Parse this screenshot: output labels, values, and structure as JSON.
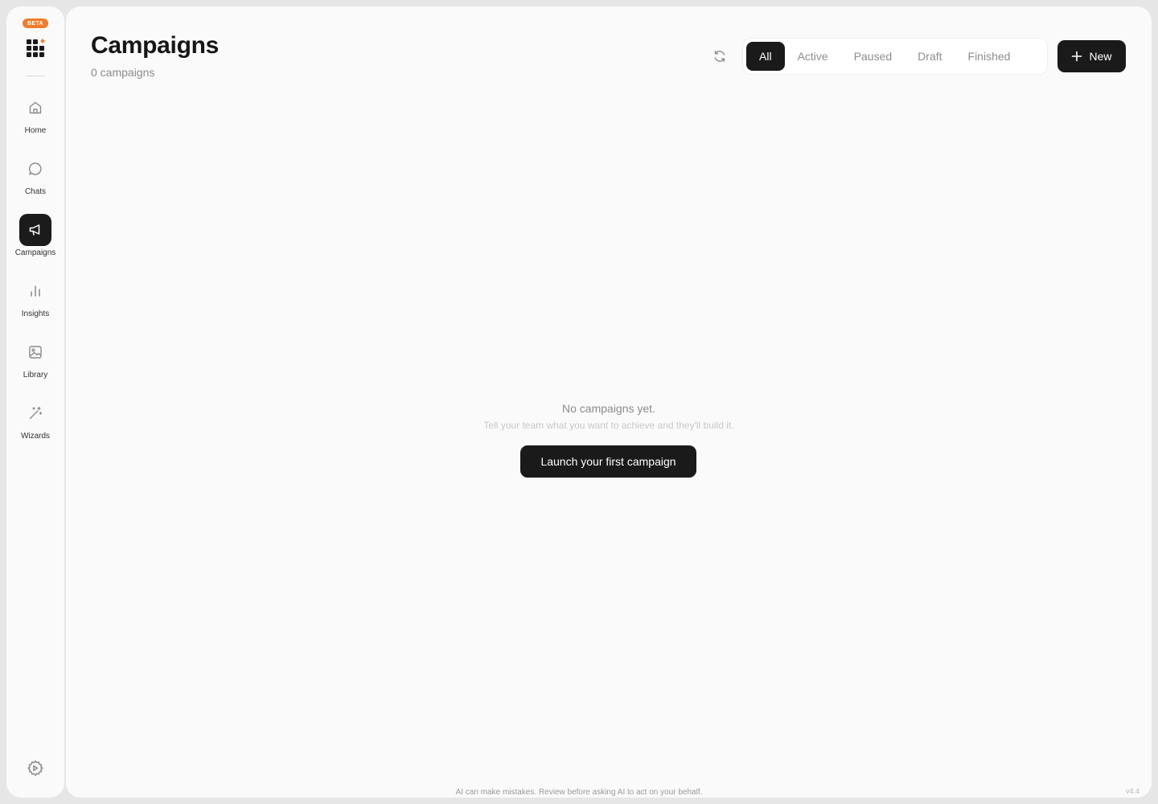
{
  "sidebar": {
    "badge": "BETA",
    "items": [
      {
        "label": "Home",
        "icon": "home-icon"
      },
      {
        "label": "Chats",
        "icon": "chat-bubble-icon"
      },
      {
        "label": "Campaigns",
        "icon": "megaphone-icon",
        "active": true
      },
      {
        "label": "Insights",
        "icon": "bar-chart-icon"
      },
      {
        "label": "Library",
        "icon": "image-icon"
      },
      {
        "label": "Wizards",
        "icon": "magic-wand-icon"
      }
    ],
    "settings_icon": "settings-gear-icon"
  },
  "header": {
    "title": "Campaigns",
    "subtitle": "0 campaigns"
  },
  "filters": {
    "tabs": [
      "All",
      "Active",
      "Paused",
      "Draft",
      "Finished"
    ],
    "selected": "All"
  },
  "new_button": {
    "label": "New",
    "icon": "plus-icon"
  },
  "empty_state": {
    "title": "No campaigns yet.",
    "subtitle": "Tell your team what you want to achieve and they'll build it.",
    "button": "Launch your first campaign"
  },
  "footer": {
    "disclaimer": "AI can make mistakes. Review before asking AI to act on your behalf.",
    "version": "v4.4"
  },
  "colors": {
    "accent_badge": "#f07c2a",
    "primary_dark": "#1a1a1a",
    "background": "#fafafa"
  }
}
